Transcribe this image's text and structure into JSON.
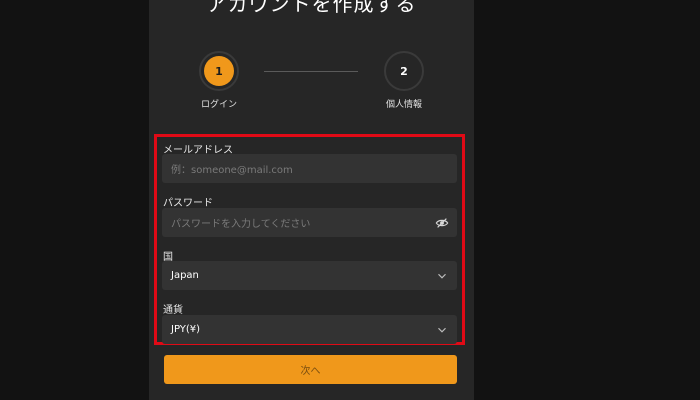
{
  "page": {
    "title": "アカウントを作成する"
  },
  "steps": [
    {
      "number": "1",
      "label": "ログイン",
      "active": true
    },
    {
      "number": "2",
      "label": "個人情報",
      "active": false
    }
  ],
  "form": {
    "email": {
      "label": "メールアドレス",
      "placeholder": "例：someone@mail.com",
      "value": ""
    },
    "password": {
      "label": "パスワード",
      "placeholder": "パスワードを入力してください",
      "value": "",
      "toggle_icon": "eye-slash-icon"
    },
    "country": {
      "label": "国",
      "value": "Japan",
      "icon": "chevron-down-icon"
    },
    "currency": {
      "label": "通貨",
      "value": "JPY(¥)",
      "icon": "chevron-down-icon"
    }
  },
  "actions": {
    "next_label": "次へ"
  },
  "colors": {
    "accent": "#f0981b",
    "highlight": "#e00a16",
    "panel": "#262626",
    "background": "#121212"
  }
}
